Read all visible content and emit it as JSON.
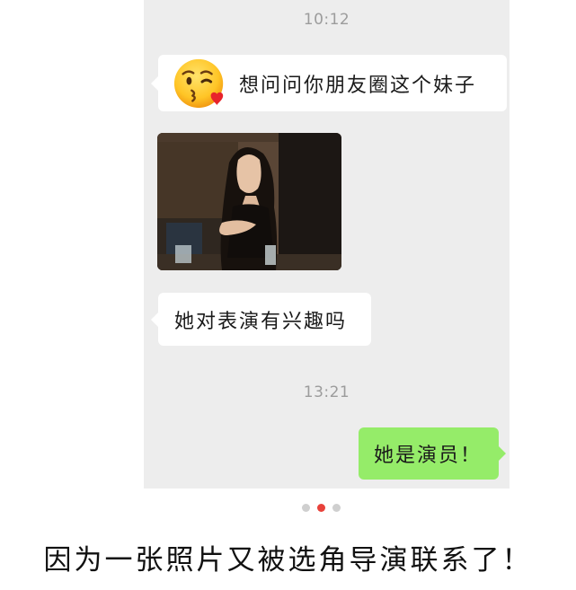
{
  "chat": {
    "timestamp_1": "10:12",
    "timestamp_2": "13:21",
    "messages": [
      {
        "side": "left",
        "type": "text",
        "emoji": "kissing-heart-emoji",
        "text": "想问问你朋友圈这个妹子"
      },
      {
        "side": "left",
        "type": "image",
        "image": "photo-of-woman"
      },
      {
        "side": "left",
        "type": "text",
        "text": "她对表演有兴趣吗"
      },
      {
        "side": "right",
        "type": "text",
        "text": "她是演员！"
      }
    ]
  },
  "pager": {
    "total": 3,
    "active_index": 1
  },
  "caption": "因为一张照片又被选角导演联系了！",
  "colors": {
    "chat_background": "#ededed",
    "incoming_bubble": "#ffffff",
    "outgoing_bubble": "#95ec69",
    "pager_active": "#e8423b",
    "pager_inactive": "#cfcfcf"
  }
}
